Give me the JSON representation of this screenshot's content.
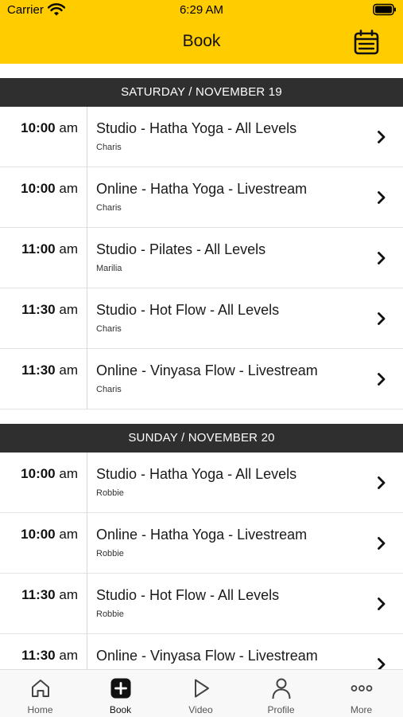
{
  "status_bar": {
    "carrier": "Carrier",
    "time": "6:29 AM"
  },
  "header": {
    "title": "Book",
    "background_color": "#ffcc00"
  },
  "days": [
    {
      "label": "SATURDAY / NOVEMBER 19",
      "classes": [
        {
          "time": "10:00",
          "ampm": "am",
          "name": "Studio - Hatha Yoga - All Levels",
          "instructor": "Charis"
        },
        {
          "time": "10:00",
          "ampm": "am",
          "name": "Online - Hatha Yoga - Livestream",
          "instructor": "Charis"
        },
        {
          "time": "11:00",
          "ampm": "am",
          "name": "Studio - Pilates - All Levels",
          "instructor": "Marilia"
        },
        {
          "time": "11:30",
          "ampm": "am",
          "name": "Studio - Hot Flow - All Levels",
          "instructor": "Charis"
        },
        {
          "time": "11:30",
          "ampm": "am",
          "name": "Online - Vinyasa Flow - Livestream",
          "instructor": "Charis"
        }
      ]
    },
    {
      "label": "SUNDAY / NOVEMBER 20",
      "classes": [
        {
          "time": "10:00",
          "ampm": "am",
          "name": "Studio - Hatha Yoga - All Levels",
          "instructor": "Robbie"
        },
        {
          "time": "10:00",
          "ampm": "am",
          "name": "Online - Hatha Yoga - Livestream",
          "instructor": "Robbie"
        },
        {
          "time": "11:30",
          "ampm": "am",
          "name": "Studio - Hot Flow - All Levels",
          "instructor": "Robbie"
        },
        {
          "time": "11:30",
          "ampm": "am",
          "name": "Online - Vinyasa Flow - Livestream",
          "instructor": ""
        }
      ]
    }
  ],
  "tabbar": {
    "tabs": [
      {
        "label": "Home",
        "icon": "home-icon"
      },
      {
        "label": "Book",
        "icon": "plus-square-icon",
        "active": true
      },
      {
        "label": "Video",
        "icon": "play-icon"
      },
      {
        "label": "Profile",
        "icon": "person-icon"
      },
      {
        "label": "More",
        "icon": "more-dots-icon"
      }
    ]
  }
}
